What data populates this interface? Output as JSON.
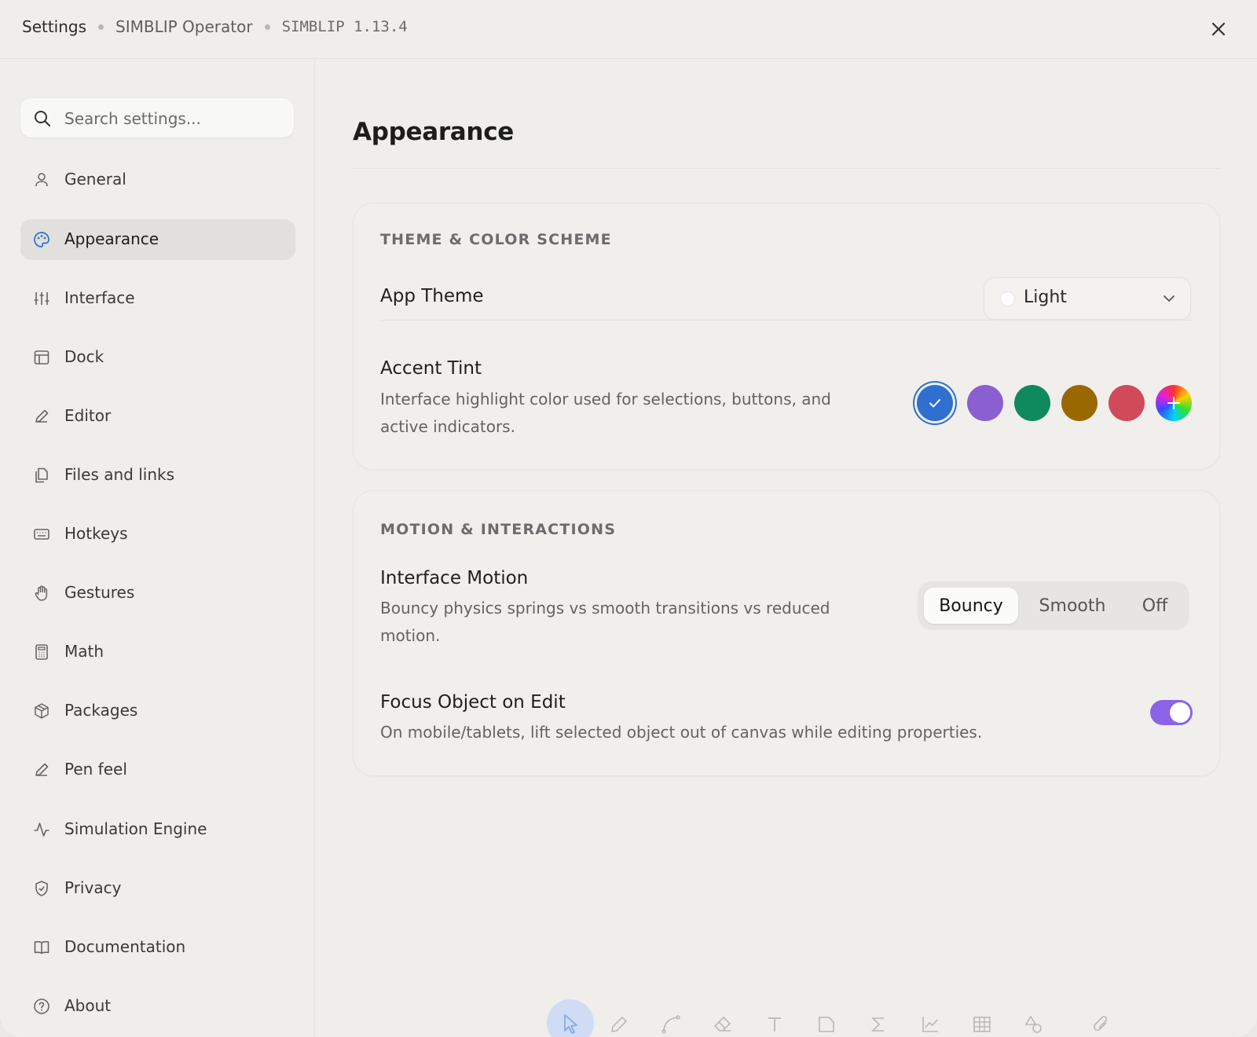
{
  "header": {
    "crumb_settings": "Settings",
    "crumb_operator": "SIMBLIP Operator",
    "crumb_version": "SIMBLIP 1.13.4"
  },
  "search": {
    "placeholder": "Search settings..."
  },
  "sidebar": {
    "items": [
      {
        "label": "General",
        "icon": "person-icon"
      },
      {
        "label": "Appearance",
        "icon": "palette-icon",
        "active": true
      },
      {
        "label": "Interface",
        "icon": "sliders-icon"
      },
      {
        "label": "Dock",
        "icon": "layout-icon"
      },
      {
        "label": "Editor",
        "icon": "pencil-icon"
      },
      {
        "label": "Files and links",
        "icon": "files-icon"
      },
      {
        "label": "Hotkeys",
        "icon": "keyboard-icon"
      },
      {
        "label": "Gestures",
        "icon": "hand-icon"
      },
      {
        "label": "Math",
        "icon": "calculator-icon"
      },
      {
        "label": "Packages",
        "icon": "package-icon"
      },
      {
        "label": "Pen feel",
        "icon": "pen-icon"
      },
      {
        "label": "Simulation Engine",
        "icon": "activity-icon"
      },
      {
        "label": "Privacy",
        "icon": "shield-icon"
      },
      {
        "label": "Documentation",
        "icon": "book-icon"
      },
      {
        "label": "About",
        "icon": "help-circle-icon"
      }
    ]
  },
  "main": {
    "title": "Appearance",
    "theme_section": {
      "heading": "THEME & COLOR SCHEME",
      "app_theme_label": "App Theme",
      "app_theme_value": "Light",
      "accent_label": "Accent Tint",
      "accent_desc": "Interface highlight color used for selections, buttons, and active indicators.",
      "accent_colors": [
        "#2e6fd0",
        "#8a5fd0",
        "#0f8a5f",
        "#9a6800",
        "#d04a5a",
        "rainbow"
      ],
      "accent_selected": 0
    },
    "motion_section": {
      "heading": "MOTION & INTERACTIONS",
      "motion_label": "Interface Motion",
      "motion_desc": "Bouncy physics springs vs smooth transitions vs reduced motion.",
      "motion_options": [
        "Bouncy",
        "Smooth",
        "Off"
      ],
      "motion_selected": "Bouncy",
      "focus_label": "Focus Object on Edit",
      "focus_desc": "On mobile/tablets, lift selected object out of canvas while editing properties.",
      "focus_enabled": true
    }
  },
  "colors": {
    "accent": "#2e6fd0",
    "toggle_on": "#8a63e8"
  }
}
